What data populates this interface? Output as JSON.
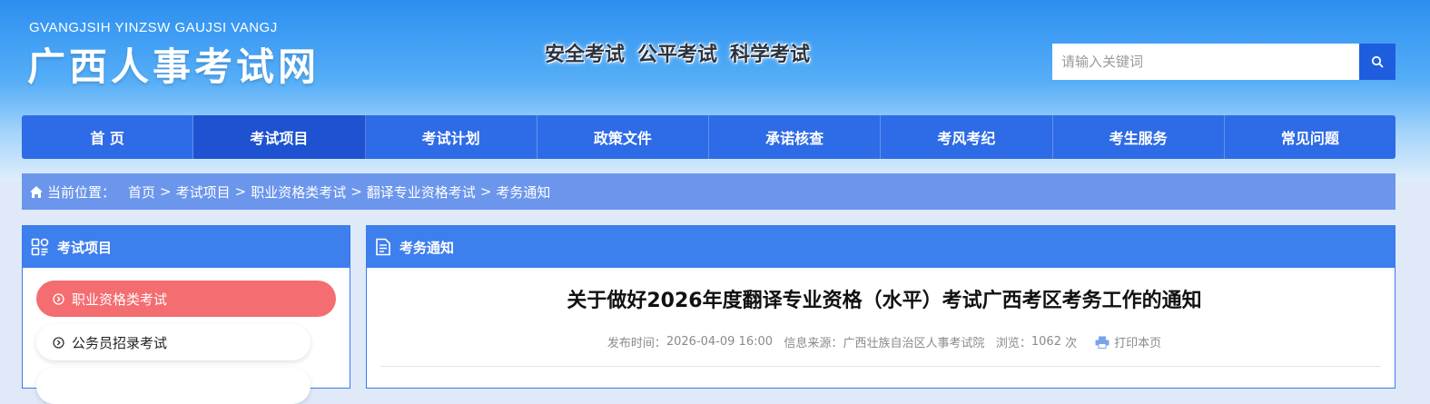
{
  "header": {
    "logo_pinyin": "GVANGJSIH YINZSW GAUJSI VANGJ",
    "logo_text": "广西人事考试网",
    "slogans": [
      "安全考试",
      "公平考试",
      "科学考试"
    ],
    "search_placeholder": "请输入关键词",
    "search_icon": "search-icon"
  },
  "nav": {
    "items": [
      {
        "label": "首 页"
      },
      {
        "label": "考试项目",
        "active": true
      },
      {
        "label": "考试计划"
      },
      {
        "label": "政策文件"
      },
      {
        "label": "承诺核查"
      },
      {
        "label": "考风考纪"
      },
      {
        "label": "考生服务"
      },
      {
        "label": "常见问题"
      }
    ]
  },
  "breadcrumb": {
    "label": "当前位置：",
    "items": [
      "首页",
      "考试项目",
      "职业资格类考试",
      "翻译专业资格考试",
      "考务通知"
    ],
    "separator": ">"
  },
  "sidebar": {
    "title": "考试项目",
    "items": [
      {
        "label": "职业资格类考试",
        "active": true
      },
      {
        "label": "公务员招录考试"
      }
    ]
  },
  "main": {
    "section_title": "考务通知",
    "article_title": "关于做好2026年度翻译专业资格（水平）考试广西考区考务工作的通知",
    "publish_label": "发布时间：",
    "publish_time": "2026-04-09 16:00",
    "source_label": "信息来源：",
    "source": "广西壮族自治区人事考试院",
    "views_label": "浏览：",
    "views": "1062",
    "views_unit": "次",
    "print_label": "打印本页"
  },
  "colors": {
    "nav_bg": "#2e6be6",
    "nav_active": "#1e52d0",
    "panel_head": "#3e7fee",
    "sidebar_active": "#f46d70",
    "breadcrumb_bg": "#6b96ec"
  }
}
